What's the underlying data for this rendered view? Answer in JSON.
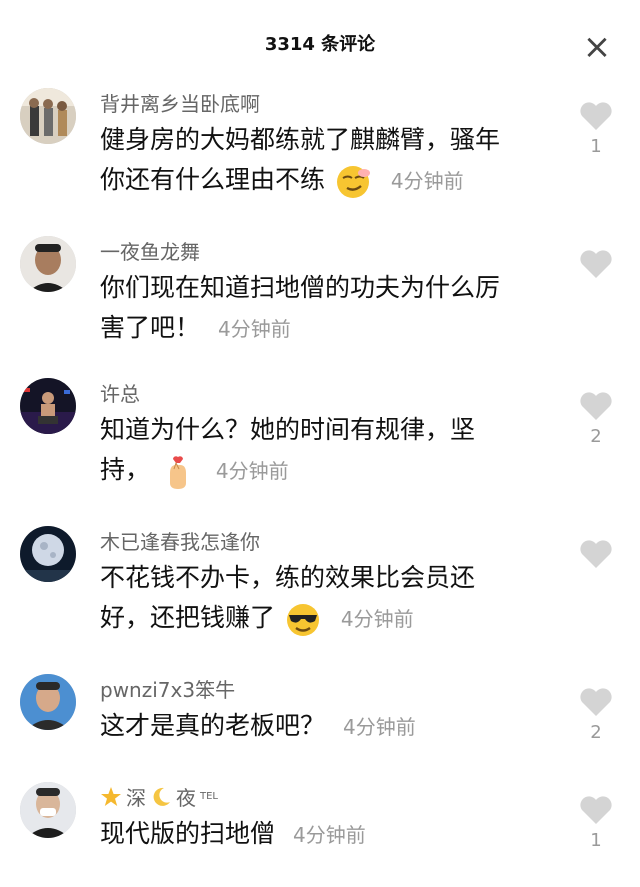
{
  "header": {
    "title": "3314 条评论",
    "close_label": "×"
  },
  "comments": [
    {
      "username": "背井离乡当卧底啊",
      "text_line1": "健身房的大妈都练就了麒麟臂，骚年",
      "text_line2": "你还有什么理由不练",
      "emoji": "smirk-emoji",
      "time": "4分钟前",
      "likes": "1"
    },
    {
      "username": "一夜鱼龙舞",
      "text_line1": "你们现在知道扫地僧的功夫为什么厉",
      "text_line2": "害了吧！",
      "time": "4分钟前",
      "likes": ""
    },
    {
      "username": "许总",
      "text_line1": "知道为什么？她的时间有规律，坚",
      "text_line2": "持，",
      "emoji": "finger-heart-emoji",
      "time": "4分钟前",
      "likes": "2"
    },
    {
      "username": "木已逢春我怎逢你",
      "text_line1": "不花钱不办卡，练的效果比会员还",
      "text_line2": "好，还把钱赚了",
      "emoji": "sunglasses-emoji",
      "time": "4分钟前",
      "likes": ""
    },
    {
      "username": "pwnzi7x3笨牛",
      "text_line1": "这才是真的老板吧？",
      "time": "4分钟前",
      "likes": "2"
    },
    {
      "username_part1": "深",
      "username_part2": "夜",
      "username_sup": "TEL",
      "text_line1": "现代版的扫地僧",
      "time": "4分钟前",
      "likes": "1"
    }
  ]
}
